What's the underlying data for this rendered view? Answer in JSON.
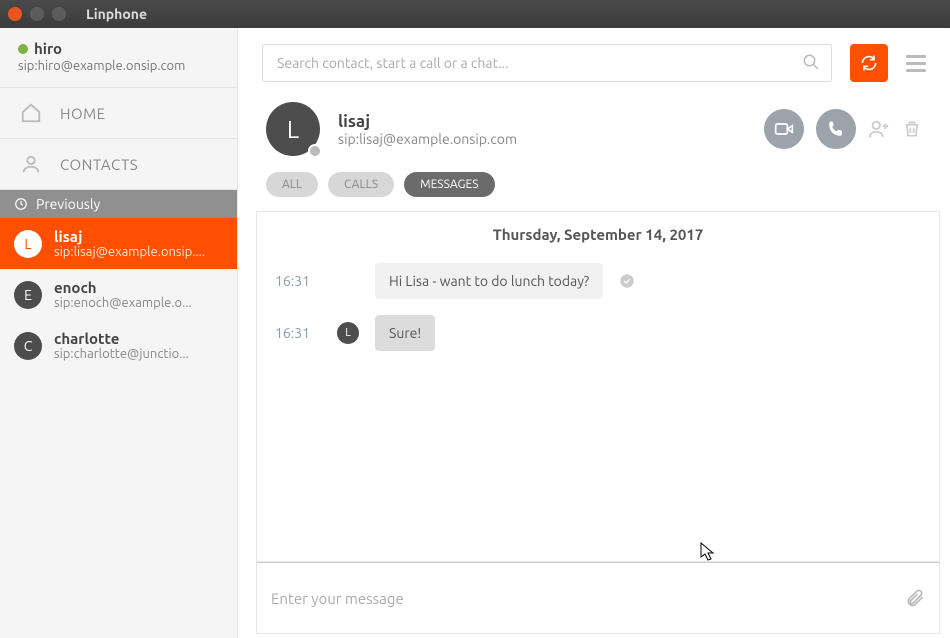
{
  "window": {
    "title": "Linphone"
  },
  "user": {
    "name": "hiro",
    "sip": "sip:hiro@example.onsip.com"
  },
  "nav": {
    "home": "HOME",
    "contacts": "CONTACTS"
  },
  "section": {
    "previously": "Previously"
  },
  "contacts": [
    {
      "initial": "L",
      "name": "lisaj",
      "sip": "sip:lisaj@example.onsip...."
    },
    {
      "initial": "E",
      "name": "enoch",
      "sip": "sip:enoch@example.o..."
    },
    {
      "initial": "C",
      "name": "charlotte",
      "sip": "sip:charlotte@junctio..."
    }
  ],
  "search": {
    "placeholder": "Search contact, start a call or a chat..."
  },
  "chat": {
    "initial": "L",
    "name": "lisaj",
    "sip": "sip:lisaj@example.onsip.com",
    "tabs": {
      "all": "ALL",
      "calls": "CALLS",
      "messages": "MESSAGES"
    },
    "date": "Thursday, September 14, 2017",
    "messages": [
      {
        "time": "16:31",
        "text": "Hi Lisa - want to do lunch today?",
        "outgoing": true
      },
      {
        "time": "16:31",
        "text": "Sure!",
        "outgoing": false,
        "initial": "L"
      }
    ],
    "composer_placeholder": "Enter your message"
  }
}
